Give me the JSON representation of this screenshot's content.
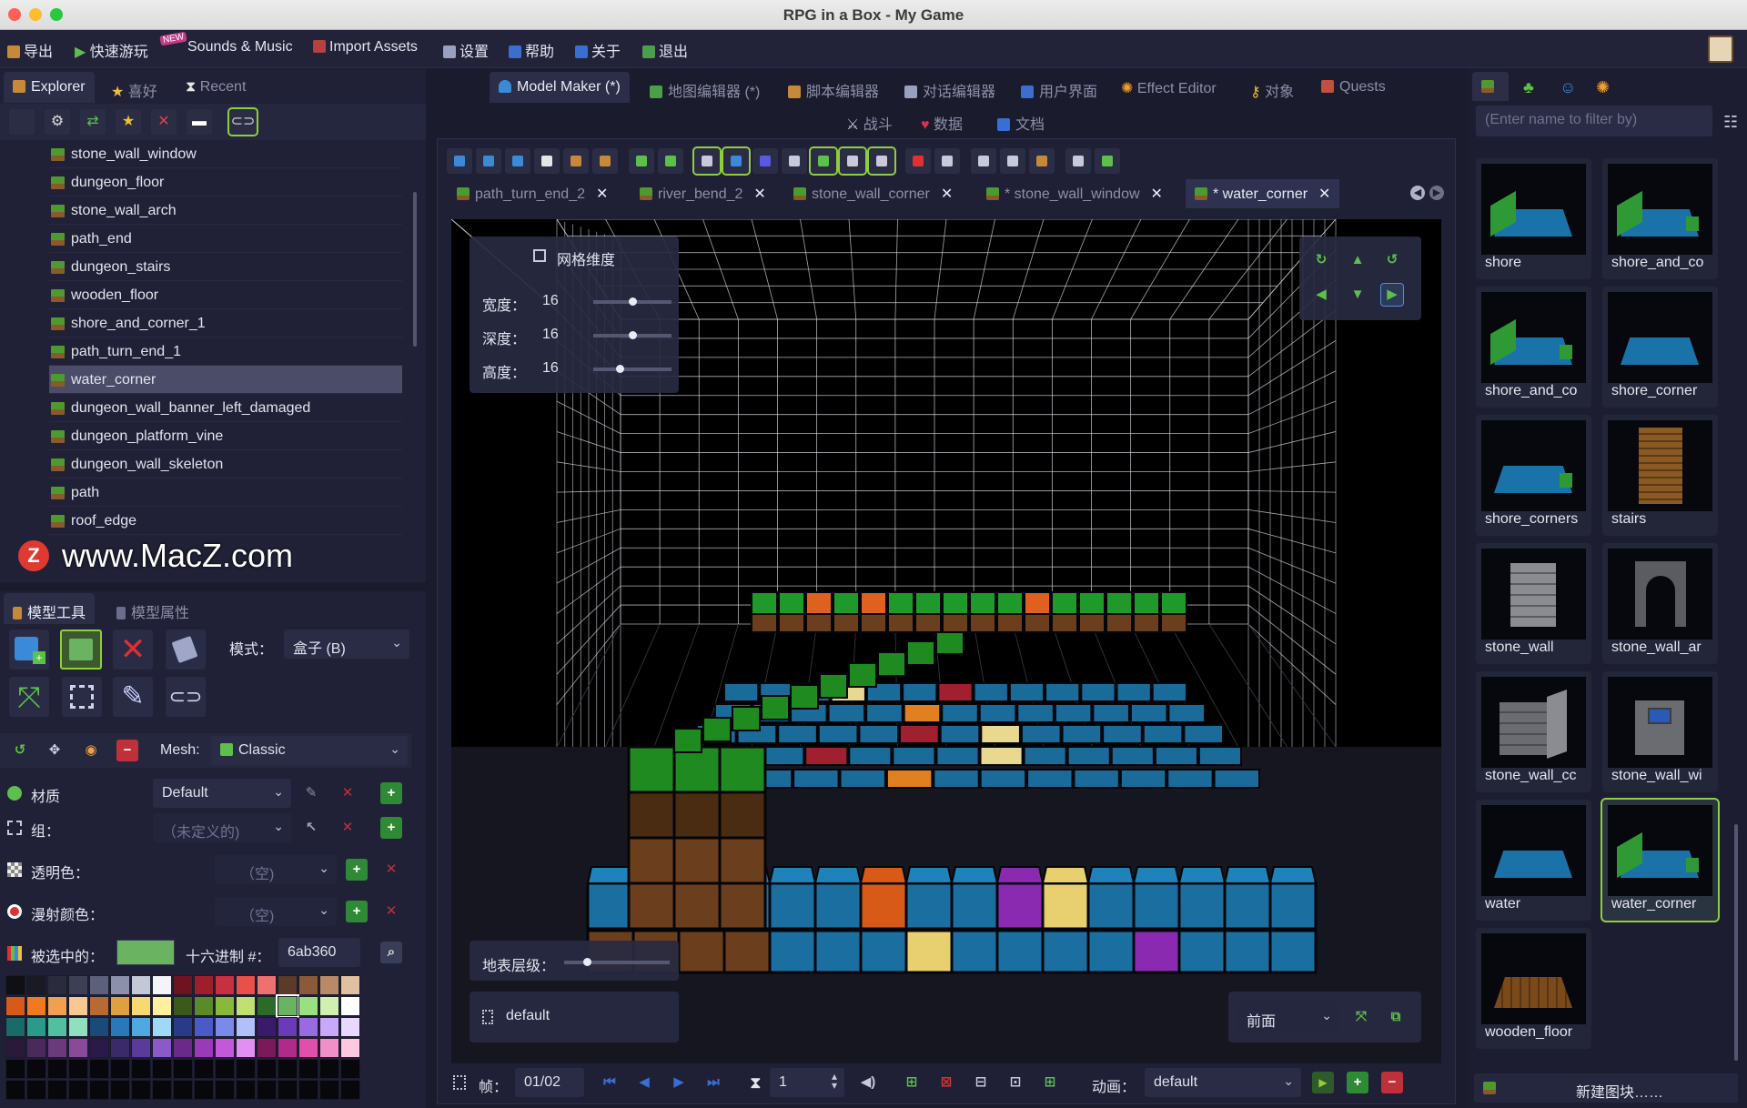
{
  "window": {
    "title": "RPG in a Box - My Game"
  },
  "menu": {
    "export": "导出",
    "quick_play": "快速游玩",
    "new_badge": "NEW",
    "sounds_music": "Sounds & Music",
    "import_assets": "Import Assets",
    "settings": "设置",
    "help": "帮助",
    "about": "关于",
    "quit": "退出"
  },
  "explorer": {
    "tabs": [
      "Explorer",
      "喜好",
      "Recent"
    ],
    "items": [
      "stone_wall_window",
      "dungeon_floor",
      "stone_wall_arch",
      "path_end",
      "dungeon_stairs",
      "wooden_floor",
      "shore_and_corner_1",
      "path_turn_end_1",
      "water_corner",
      "dungeon_wall_banner_left_damaged",
      "dungeon_platform_vine",
      "dungeon_wall_skeleton",
      "path",
      "roof_edge"
    ],
    "selected": "water_corner"
  },
  "watermark": "www.MacZ.com",
  "tools": {
    "tabs": [
      "模型工具",
      "模型属性"
    ],
    "mode_label": "模式：",
    "mode_value": "盒子 (B)",
    "mesh_label": "Mesh:",
    "mesh_value": "Classic",
    "material_label": "材质",
    "material_value": "Default",
    "group_label": "组：",
    "group_value": "（未定义的)",
    "transparent_label": "透明色：",
    "transparent_value": "（空)",
    "diffuse_label": "漫射颜色：",
    "diffuse_value": "（空)",
    "selected_label": "被选中的：",
    "hex_label": "十六进制 #：",
    "hex_value": "6ab360",
    "selected_color": "#6ab360"
  },
  "editor_tabs": {
    "row1": [
      "Model Maker (*)",
      "地图编辑器 (*)",
      "脚本编辑器",
      "对话编辑器",
      "用户界面",
      "Effect Editor",
      "对象",
      "Quests"
    ],
    "row2": [
      "战斗",
      "数据",
      "文档"
    ]
  },
  "doc_tabs": [
    "path_turn_end_2",
    "river_bend_2",
    "stone_wall_corner",
    "* stone_wall_window",
    "* water_corner"
  ],
  "grid_panel": {
    "title": "网格维度",
    "width_label": "宽度：",
    "width": "16",
    "depth_label": "深度：",
    "depth": "16",
    "height_label": "高度：",
    "height": "16",
    "width_level": 0.5,
    "depth_level": 0.5,
    "height_level": 0.33
  },
  "surface_level": {
    "label": "地表层级：",
    "level": 0.2
  },
  "layer_name": "default",
  "view_select": "前面",
  "timeline": {
    "frame_label": "帧：",
    "frame": "01/02",
    "count": "1",
    "anim_label": "动画：",
    "anim_value": "default"
  },
  "library": {
    "filter_placeholder": "(Enter name to filter by)",
    "items": [
      {
        "name": "shore",
        "kind": "shore"
      },
      {
        "name": "shore_and_co",
        "kind": "shore2"
      },
      {
        "name": "shore_and_co",
        "kind": "shore2"
      },
      {
        "name": "shore_corner",
        "kind": "water"
      },
      {
        "name": "shore_corners",
        "kind": "shore3"
      },
      {
        "name": "stairs",
        "kind": "stairs"
      },
      {
        "name": "stone_wall",
        "kind": "wall"
      },
      {
        "name": "stone_wall_ar",
        "kind": "arch"
      },
      {
        "name": "stone_wall_cc",
        "kind": "wallc"
      },
      {
        "name": "stone_wall_wi",
        "kind": "window"
      },
      {
        "name": "water",
        "kind": "water"
      },
      {
        "name": "water_corner",
        "kind": "shore2"
      },
      {
        "name": "wooden_floor",
        "kind": "wood"
      }
    ],
    "selected": "water_corner",
    "new_block": "新建图块……"
  },
  "colors": {
    "accent": "#8fcf3a",
    "bg": "#1a1b2c",
    "panel": "#202136",
    "water": "#1a73a8",
    "grass": "#2f9a35",
    "dirt": "#6b3f1e"
  }
}
